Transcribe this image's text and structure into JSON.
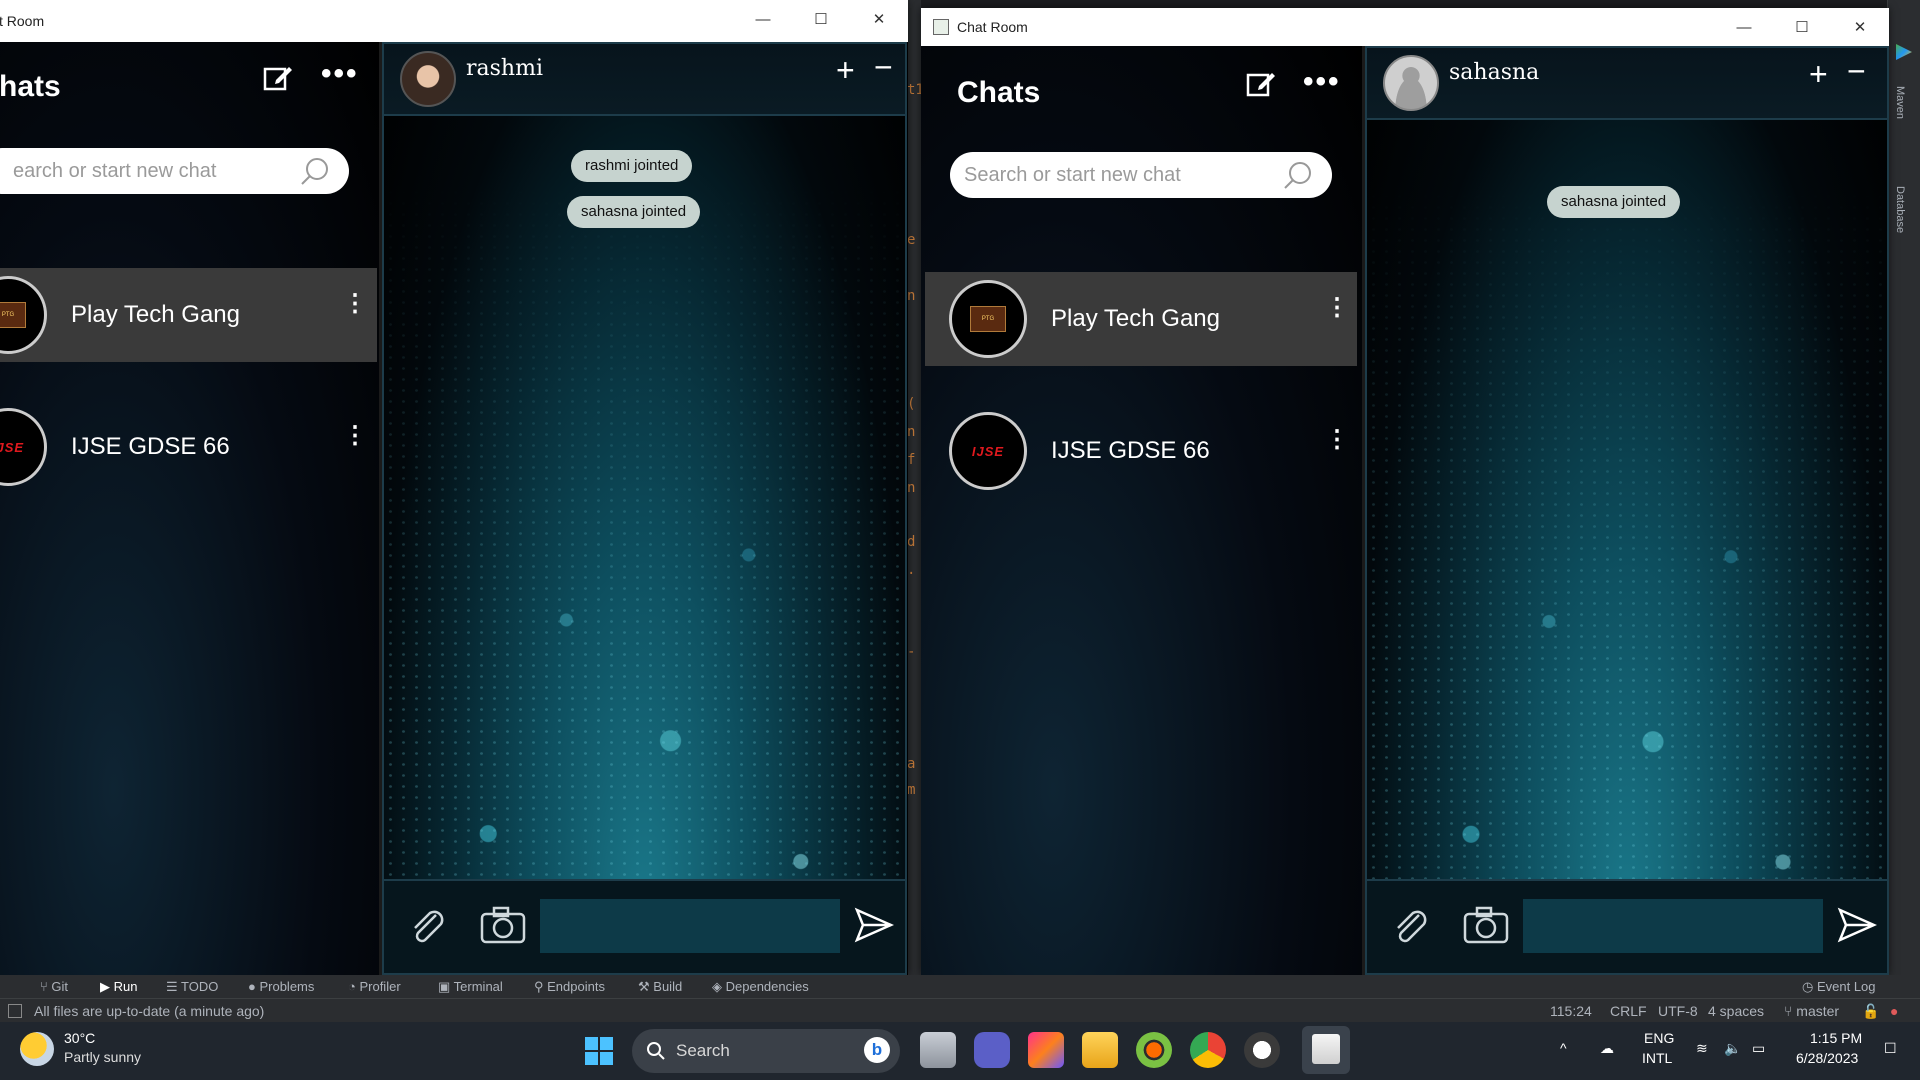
{
  "background_ide": {
    "strip_chars": [
      "t1",
      "e",
      "n",
      "(",
      "n",
      "f",
      "n",
      "d",
      ".",
      "-",
      "a",
      "m"
    ],
    "right_tools": [
      "Maven",
      "Database"
    ]
  },
  "left_window": {
    "title": "t Room",
    "list_title": "hats",
    "search_placeholder": "earch or start new chat",
    "chats": [
      {
        "name": "Play Tech Gang",
        "selected": true,
        "avatar": "play-tech-gang-logo"
      },
      {
        "name": "IJSE GDSE 66",
        "selected": false,
        "avatar": "ijse-logo"
      }
    ],
    "conversation": {
      "contact_name": "rashmi",
      "system_messages": [
        "rashmi jointed",
        "sahasna jointed"
      ]
    },
    "controls": {
      "minimize": "—",
      "maximize": "☐",
      "close": "✕"
    }
  },
  "right_window": {
    "title": "Chat Room",
    "list_title": "Chats",
    "search_placeholder": "Search or start new chat",
    "chats": [
      {
        "name": "Play Tech Gang",
        "selected": true,
        "avatar": "play-tech-gang-logo"
      },
      {
        "name": "IJSE GDSE 66",
        "selected": false,
        "avatar": "ijse-logo"
      }
    ],
    "conversation": {
      "contact_name": "sahasna",
      "system_messages": [
        "sahasna jointed"
      ]
    },
    "controls": {
      "minimize": "—",
      "maximize": "☐",
      "close": "✕"
    }
  },
  "header_buttons": {
    "plus": "+",
    "minus": "−"
  },
  "ide_toolbar": {
    "items": [
      "Git",
      "Run",
      "TODO",
      "Problems",
      "Profiler",
      "Terminal",
      "Endpoints",
      "Build",
      "Dependencies"
    ],
    "event_log": "Event Log"
  },
  "ide_status": {
    "message": "All files are up-to-date (a minute ago)",
    "position": "115:24",
    "line_ending": "CRLF",
    "encoding": "UTF-8",
    "indent": "4 spaces",
    "branch": "master"
  },
  "taskbar": {
    "weather_temp": "30°C",
    "weather_desc": "Partly sunny",
    "search_label": "Search",
    "language_1": "ENG",
    "language_2": "INTL",
    "time": "1:15 PM",
    "date": "6/28/2023"
  },
  "colors": {
    "accent_teal": "#1b7a8c",
    "selected_row": "#3a3a3a",
    "bubble": "#c6d3cf",
    "input": "#0d3a48"
  }
}
